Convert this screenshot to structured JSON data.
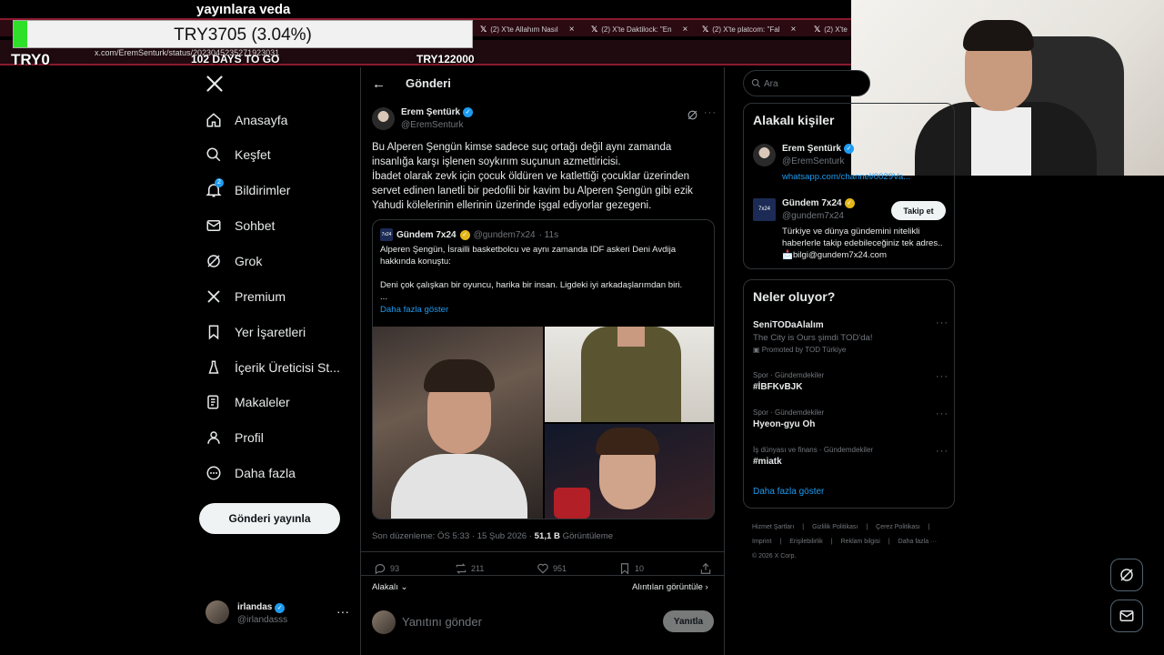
{
  "overlay": {
    "title": "yayınlara veda",
    "progress_text": "TRY3705 (3.04%)",
    "progress_fraction": 0.0304,
    "left_label": "TRY0",
    "days_label": "102 DAYS TO GO",
    "goal_label": "TRY122000"
  },
  "browser": {
    "tabs": [
      {
        "label": "(2) X'te Allahım Nasıl"
      },
      {
        "label": "(2) X'te Daktilock: \"En"
      },
      {
        "label": "(2) X'te platcom: \"Fal"
      },
      {
        "label": "(2) X'te"
      }
    ],
    "url": "x.com/EremSenturk/status/2023045235271923031"
  },
  "nav": {
    "items": [
      {
        "label": "Anasayfa",
        "icon": "home-icon"
      },
      {
        "label": "Keşfet",
        "icon": "search-icon"
      },
      {
        "label": "Bildirimler",
        "icon": "bell-icon",
        "badge": "2"
      },
      {
        "label": "Sohbet",
        "icon": "mail-icon"
      },
      {
        "label": "Grok",
        "icon": "grok-icon"
      },
      {
        "label": "Premium",
        "icon": "x-icon"
      },
      {
        "label": "Yer İşaretleri",
        "icon": "bookmark-icon"
      },
      {
        "label": "İçerik Üreticisi St...",
        "icon": "creator-icon"
      },
      {
        "label": "Makaleler",
        "icon": "article-icon"
      },
      {
        "label": "Profil",
        "icon": "profile-icon"
      },
      {
        "label": "Daha fazla",
        "icon": "more-circle-icon"
      }
    ],
    "post_button": "Gönderi yayınla",
    "me": {
      "name": "irlandas",
      "handle": "@irlandasss"
    }
  },
  "main": {
    "title": "Gönderi",
    "author": {
      "name": "Erem Şentürk",
      "handle": "@EremSenturk"
    },
    "body": "Bu Alperen Şengün kimse sadece suç ortağı değil aynı zamanda insanlığa karşı işlenen soykırım suçunun azmettiricisi.\nİbadet olarak zevk için çocuk öldüren ve katlettiği çocuklar üzerinden servet edinen lanetli bir pedofili bir kavim bu Alperen Şengün gibi ezik Yahudi kölelerinin ellerinin üzerinde işgal ediyorlar gezegeni.",
    "quote": {
      "name": "Gündem 7x24",
      "handle": "@gundem7x24",
      "time": "· 11s",
      "logo_text": "7x24",
      "text": "Alperen Şengün, İsrailli basketbolcu ve aynı zamanda IDF askeri Deni Avdija hakkında konuştu:\n\nDeni çok çalışkan bir oyuncu, harika bir insan. Ligdeki iyi arkadaşlarımdan biri.\n...",
      "show_more": "Daha fazla göster"
    },
    "meta_prefix": "Son düzenleme: ÖS 5:33 · 15 Şub 2026 · ",
    "views": "51,1 B",
    "views_label": " Görüntüleme",
    "actions": {
      "replies": "93",
      "reposts": "211",
      "likes": "951",
      "bookmarks": "10"
    },
    "relevance": "Alakalı",
    "quotes_link": "Alıntıları görüntüle ›",
    "reply_placeholder": "Yanıtını gönder",
    "reply_button": "Yanıtla"
  },
  "sidebar": {
    "search_placeholder": "Ara",
    "people_title": "Alakalı kişiler",
    "people": [
      {
        "name": "Erem Şentürk",
        "handle": "@EremSenturk",
        "bio": "whatsapp.com/channel/0029Va..."
      },
      {
        "name": "Gündem 7x24",
        "handle": "@gundem7x24",
        "bio": "Türkiye ve dünya gündemini nitelikli haberlerle takip edebileceğiniz tek adres.. 📩bilgi@gundem7x24.com",
        "follow": "Takip et",
        "logo_text": "7x24"
      }
    ],
    "trends_title": "Neler oluyor?",
    "trends": [
      {
        "category": "",
        "name": "SeniTODaAlalım",
        "sub": "The City is Ours şimdi TOD'da!",
        "promo": "Promoted by TOD Türkiye"
      },
      {
        "category": "Spor · Gündemdekiler",
        "name": "#İBFKvBJK"
      },
      {
        "category": "Spor · Gündemdekiler",
        "name": "Hyeon-gyu Oh"
      },
      {
        "category": "İş dünyası ve finans · Gündemdekiler",
        "name": "#miatk"
      }
    ],
    "trends_more": "Daha fazla göster",
    "footer": [
      "Hizmet Şartları",
      "|",
      "Gizlilik Politikası",
      "|",
      "Çerez Politikası",
      "|",
      "Imprint",
      "|",
      "Erişilebilirlik",
      "|",
      "Reklam bilgisi",
      "|",
      "Daha fazla ···",
      "© 2026 X Corp."
    ]
  },
  "colors": {
    "accent": "#1d9bf0",
    "background": "#000000",
    "border": "#2f3336",
    "progress_fill": "#2fe02a",
    "chrome": "#8a1a2e"
  }
}
